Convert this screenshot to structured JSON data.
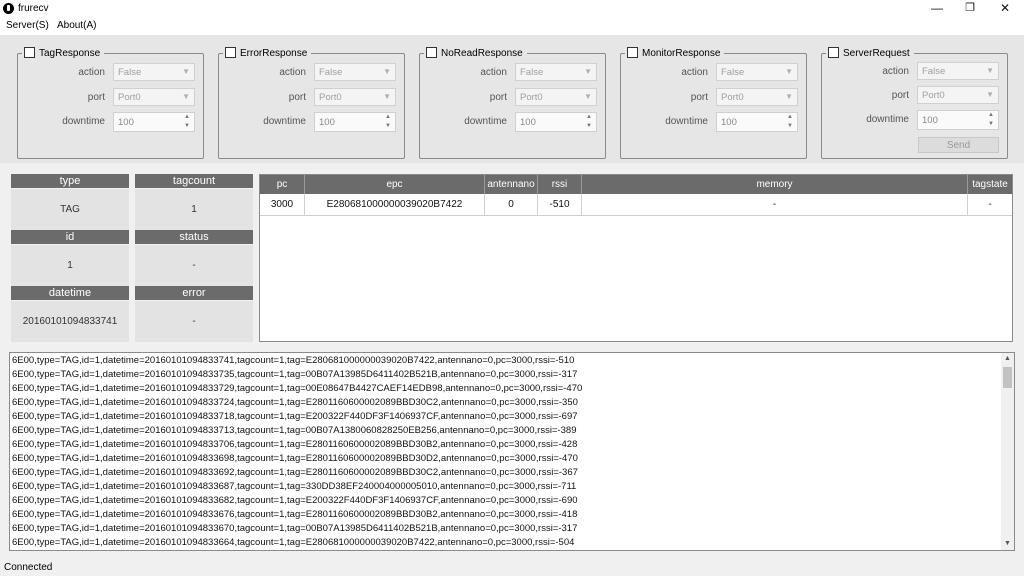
{
  "window": {
    "title": "frurecv",
    "controls": {
      "minimize": "—",
      "restore": "❐",
      "close": "✕"
    }
  },
  "menu": [
    "Server(S)",
    "About(A)"
  ],
  "groups": [
    {
      "title": "TagResponse",
      "action_label": "action",
      "action_value": "False",
      "port_label": "port",
      "port_value": "Port0",
      "downtime_label": "downtime",
      "downtime_value": "100"
    },
    {
      "title": "ErrorResponse",
      "action_label": "action",
      "action_value": "False",
      "port_label": "port",
      "port_value": "Port0",
      "downtime_label": "downtime",
      "downtime_value": "100"
    },
    {
      "title": "NoReadResponse",
      "action_label": "action",
      "action_value": "False",
      "port_label": "port",
      "port_value": "Port0",
      "downtime_label": "downtime",
      "downtime_value": "100"
    },
    {
      "title": "MonitorResponse",
      "action_label": "action",
      "action_value": "False",
      "port_label": "port",
      "port_value": "Port0",
      "downtime_label": "downtime",
      "downtime_value": "100"
    },
    {
      "title": "ServerRequest",
      "action_label": "action",
      "action_value": "False",
      "port_label": "port",
      "port_value": "Port0",
      "downtime_label": "downtime",
      "downtime_value": "100",
      "send_label": "Send"
    }
  ],
  "info": {
    "type_label": "type",
    "type_value": "TAG",
    "tagcount_label": "tagcount",
    "tagcount_value": "1",
    "id_label": "id",
    "id_value": "1",
    "status_label": "status",
    "status_value": "-",
    "datetime_label": "datetime",
    "datetime_value": "20160101094833741",
    "error_label": "error",
    "error_value": "-"
  },
  "table": {
    "columns": [
      "pc",
      "epc",
      "antennano",
      "rssi",
      "memory",
      "tagstate"
    ],
    "rows": [
      [
        "3000",
        "E280681000000039020B7422",
        "0",
        "-510",
        "-",
        "-"
      ]
    ]
  },
  "log": [
    "6E00,type=TAG,id=1,datetime=20160101094833741,tagcount=1,tag=E280681000000039020B7422,antennano=0,pc=3000,rssi=-510",
    "6E00,type=TAG,id=1,datetime=20160101094833735,tagcount=1,tag=00B07A13985D6411402B521B,antennano=0,pc=3000,rssi=-317",
    "6E00,type=TAG,id=1,datetime=20160101094833729,tagcount=1,tag=00E08647B4427CAEF14EDB98,antennano=0,pc=3000,rssi=-470",
    "6E00,type=TAG,id=1,datetime=20160101094833724,tagcount=1,tag=E2801160600002089BBD30C2,antennano=0,pc=3000,rssi=-350",
    "6E00,type=TAG,id=1,datetime=20160101094833718,tagcount=1,tag=E200322F440DF3F1406937CF,antennano=0,pc=3000,rssi=-697",
    "6E00,type=TAG,id=1,datetime=20160101094833713,tagcount=1,tag=00B07A1380060828250EB256,antennano=0,pc=3000,rssi=-389",
    "6E00,type=TAG,id=1,datetime=20160101094833706,tagcount=1,tag=E2801160600002089BBD30B2,antennano=0,pc=3000,rssi=-428",
    "6E00,type=TAG,id=1,datetime=20160101094833698,tagcount=1,tag=E2801160600002089BBD30D2,antennano=0,pc=3000,rssi=-470",
    "6E00,type=TAG,id=1,datetime=20160101094833692,tagcount=1,tag=E2801160600002089BBD30C2,antennano=0,pc=3000,rssi=-367",
    "6E00,type=TAG,id=1,datetime=20160101094833687,tagcount=1,tag=330DD38EF240004000005010,antennano=0,pc=3000,rssi=-711",
    "6E00,type=TAG,id=1,datetime=20160101094833682,tagcount=1,tag=E200322F440DF3F1406937CF,antennano=0,pc=3000,rssi=-690",
    "6E00,type=TAG,id=1,datetime=20160101094833676,tagcount=1,tag=E2801160600002089BBD30B2,antennano=0,pc=3000,rssi=-418",
    "6E00,type=TAG,id=1,datetime=20160101094833670,tagcount=1,tag=00B07A13985D6411402B521B,antennano=0,pc=3000,rssi=-317",
    "6E00,type=TAG,id=1,datetime=20160101094833664,tagcount=1,tag=E280681000000039020B7422,antennano=0,pc=3000,rssi=-504"
  ],
  "status": "Connected"
}
